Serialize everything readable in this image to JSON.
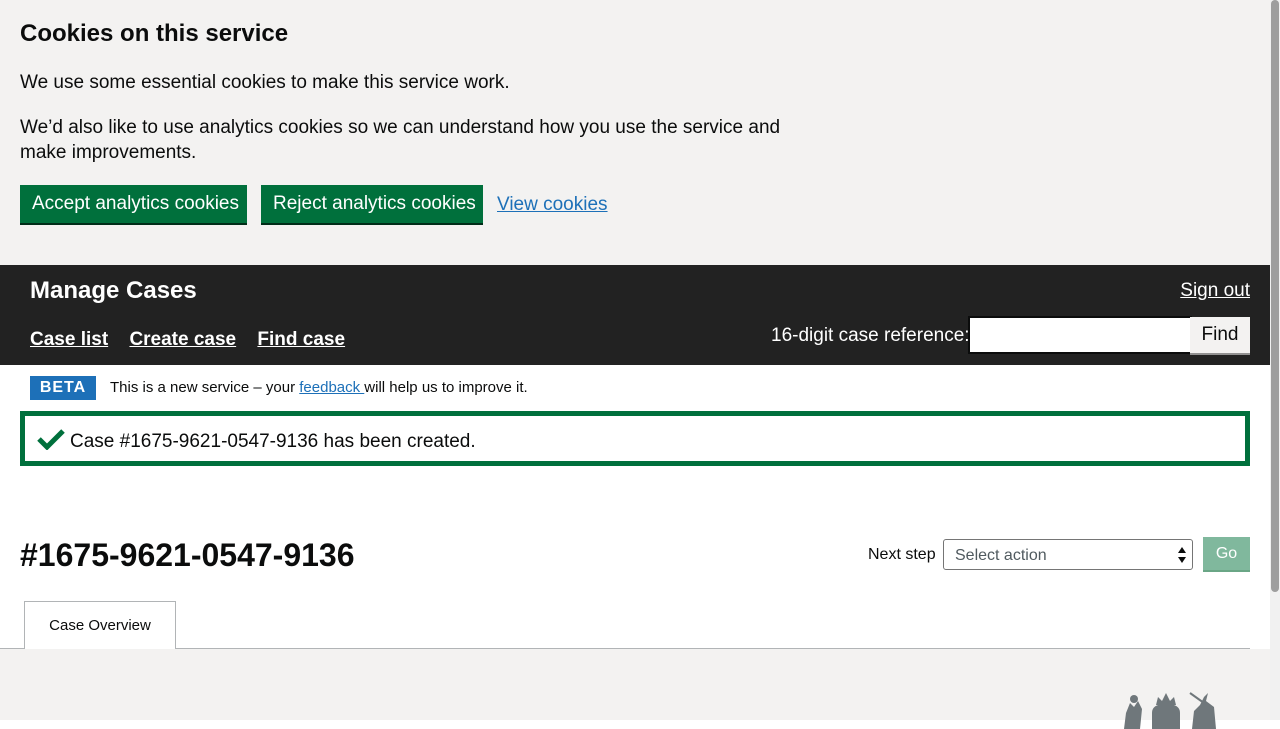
{
  "cookie_banner": {
    "heading": "Cookies on this service",
    "paragraph1": "We use some essential cookies to make this service work.",
    "paragraph2": "We’d also like to use analytics cookies so we can understand how you use the service and make improvements.",
    "accept_label": "Accept analytics cookies",
    "reject_label": "Reject analytics cookies",
    "view_link": "View cookies"
  },
  "header": {
    "service_name": "Manage Cases",
    "sign_out": "Sign out",
    "nav": [
      "Case list",
      "Create case",
      "Find case"
    ],
    "case_ref_label": "16-digit case reference:",
    "case_ref_value": "",
    "find_label": "Find"
  },
  "beta_banner": {
    "tag": "BETA",
    "text_before": "This is a new service – your ",
    "link": " feedback ",
    "text_after": " will help us to improve it."
  },
  "alert": {
    "icon": "check-icon",
    "message": "Case #1675-9621-0547-9136 has been created."
  },
  "case": {
    "title": "#1675-9621-0547-9136",
    "next_step_label": "Next step",
    "select_value": "Select action",
    "go_label": "Go",
    "tabs": [
      "Case Overview"
    ]
  },
  "colors": {
    "primary_green": "#00703c",
    "header_bg": "#222222",
    "link_blue": "#1d70b8",
    "banner_bg": "#f3f2f1"
  }
}
